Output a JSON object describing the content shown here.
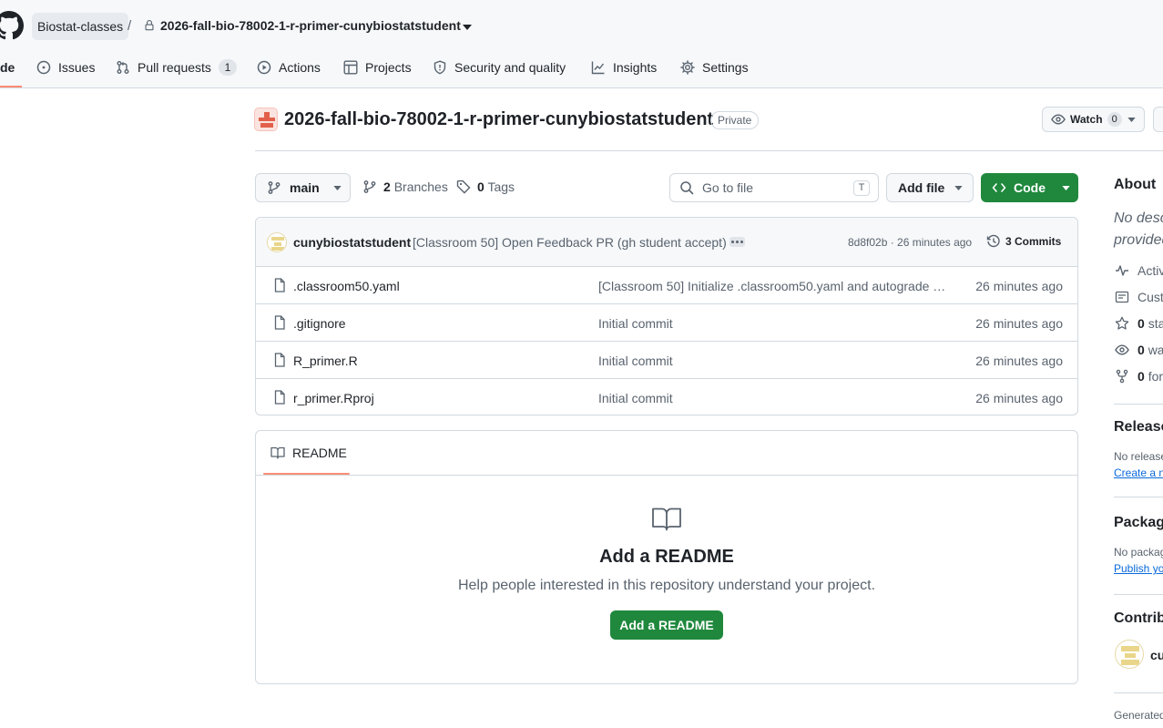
{
  "breadcrumb": {
    "owner": "Biostat-classes",
    "separator": "/",
    "repo": "2026-fall-bio-78002-1-r-primer-cunybiostatstudent"
  },
  "nav": {
    "code_partial": "de",
    "issues": "Issues",
    "pull_requests": "Pull requests",
    "pull_requests_count": "1",
    "actions": "Actions",
    "projects": "Projects",
    "security": "Security and quality",
    "insights": "Insights",
    "settings": "Settings"
  },
  "repo": {
    "title": "2026-fall-bio-78002-1-r-primer-cunybiostatstudent",
    "visibility": "Private",
    "watch_label": "Watch",
    "watch_count": "0"
  },
  "file_nav": {
    "branch": "main",
    "branches_count": "2",
    "branches_label": "Branches",
    "tags_count": "0",
    "tags_label": "Tags",
    "search_placeholder": "Go to file",
    "search_shortcut": "T",
    "add_file": "Add file",
    "code": "Code"
  },
  "latest_commit": {
    "author": "cunybiostatstudent",
    "message": "[Classroom 50] Open Feedback PR (gh student accept)",
    "hash_time": "8d8f02b · 26 minutes ago",
    "commits": "3 Commits"
  },
  "files": [
    {
      "name": ".classroom50.yaml",
      "message": "[Classroom 50] Initialize .classroom50.yaml and autograde w...",
      "time": "26 minutes ago"
    },
    {
      "name": ".gitignore",
      "message": "Initial commit",
      "time": "26 minutes ago"
    },
    {
      "name": "R_primer.R",
      "message": "Initial commit",
      "time": "26 minutes ago"
    },
    {
      "name": "r_primer.Rproj",
      "message": "Initial commit",
      "time": "26 minutes ago"
    }
  ],
  "readme": {
    "tab": "README",
    "heading": "Add a README",
    "subtext": "Help people interested in this repository understand your project.",
    "button": "Add a README"
  },
  "sidebar": {
    "about_heading": "About",
    "description_line1": "No desc",
    "description_line2": "provided",
    "activity": "Activ",
    "custom": "Custo",
    "stars_count": "0",
    "stars_label": "sta",
    "watchers_count": "0",
    "watchers_label": "wa",
    "forks_count": "0",
    "forks_label": "for",
    "releases_heading": "Release",
    "releases_text": "No release",
    "releases_link": "Create a n",
    "packages_heading": "Packag",
    "packages_text": "No packag",
    "packages_link": "Publish yo",
    "contributors_heading": "Contrib",
    "contributor_name": "cu",
    "generated": "Generated"
  },
  "colors": {
    "primary_green": "#1f883d",
    "accent_underline": "#fd8c73",
    "link_blue": "#0969da",
    "muted_text": "#59636e",
    "border": "#d1d9e0"
  }
}
